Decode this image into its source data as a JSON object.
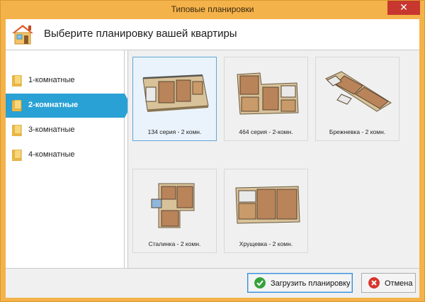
{
  "window": {
    "title": "Типовые планировки",
    "close_glyph": "✕",
    "accent": "#f4b24a"
  },
  "header": {
    "title": "Выберите планировку вашей квартиры",
    "icon": "house-icon"
  },
  "sidebar": {
    "items": [
      {
        "label": "1-комнатные",
        "icon": "folder-icon",
        "active": false
      },
      {
        "label": "2-комнатные",
        "icon": "folder-icon",
        "active": true
      },
      {
        "label": "3-комнатные",
        "icon": "folder-icon",
        "active": false
      },
      {
        "label": "4-комнатные",
        "icon": "folder-icon",
        "active": false
      }
    ],
    "active_color": "#2aa1d4"
  },
  "layouts": [
    {
      "caption": "134 серия - 2 комн.",
      "selected": true
    },
    {
      "caption": "464 серия - 2-комн.",
      "selected": false
    },
    {
      "caption": "Брежневка - 2 комн.",
      "selected": false
    },
    {
      "caption": "Сталинка - 2 комн.",
      "selected": false
    },
    {
      "caption": "Хрущевка - 2 комн.",
      "selected": false
    }
  ],
  "footer": {
    "load_label": "Загрузить планировку",
    "load_icon": "check-icon",
    "cancel_label": "Отмена",
    "cancel_icon": "cancel-icon"
  }
}
